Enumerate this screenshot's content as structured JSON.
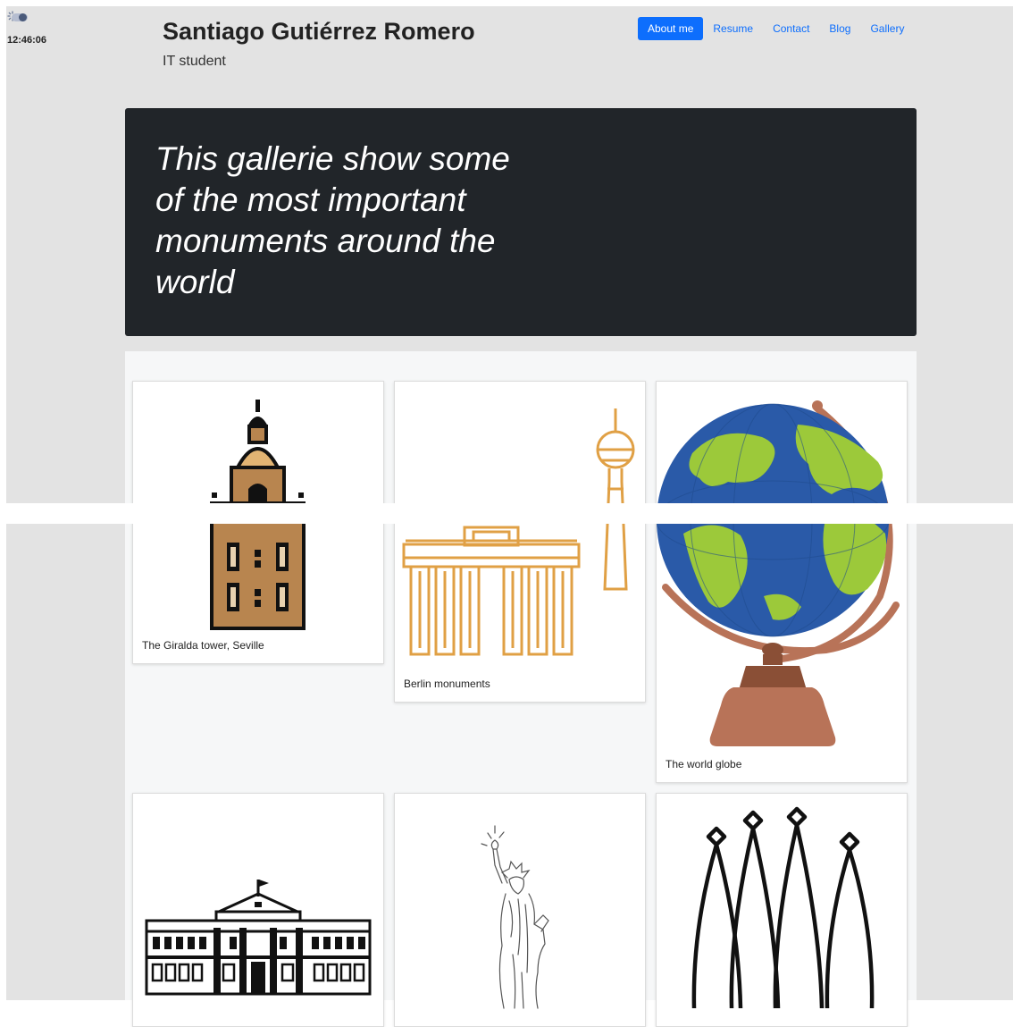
{
  "widget": {
    "time": "12:46:06"
  },
  "header": {
    "name": "Santiago Gutiérrez Romero",
    "role": "IT student"
  },
  "nav": {
    "items": [
      {
        "label": "About me",
        "active": true
      },
      {
        "label": "Resume",
        "active": false
      },
      {
        "label": "Contact",
        "active": false
      },
      {
        "label": "Blog",
        "active": false
      },
      {
        "label": "Gallery",
        "active": false
      }
    ]
  },
  "hero": {
    "title": "This gallerie show some of the most important monuments around the world"
  },
  "gallery": {
    "cards": [
      {
        "icon": "giralda-tower-icon",
        "caption": "The Giralda tower, Seville"
      },
      {
        "icon": "berlin-monuments-icon",
        "caption": "Berlin monuments"
      },
      {
        "icon": "world-globe-icon",
        "caption": "The world globe"
      },
      {
        "icon": "white-house-icon",
        "caption": ""
      },
      {
        "icon": "statue-of-liberty-icon",
        "caption": ""
      },
      {
        "icon": "sagrada-familia-icon",
        "caption": ""
      }
    ]
  },
  "colors": {
    "page_background": "#e3e3e3",
    "hero_background": "#212529",
    "accent": "#0d6efd",
    "tower_brown": "#b8854f",
    "gate_orange": "#e0a045",
    "globe_blue": "#2a5aa8",
    "globe_green": "#9cc93a",
    "globe_stand": "#b87358"
  }
}
